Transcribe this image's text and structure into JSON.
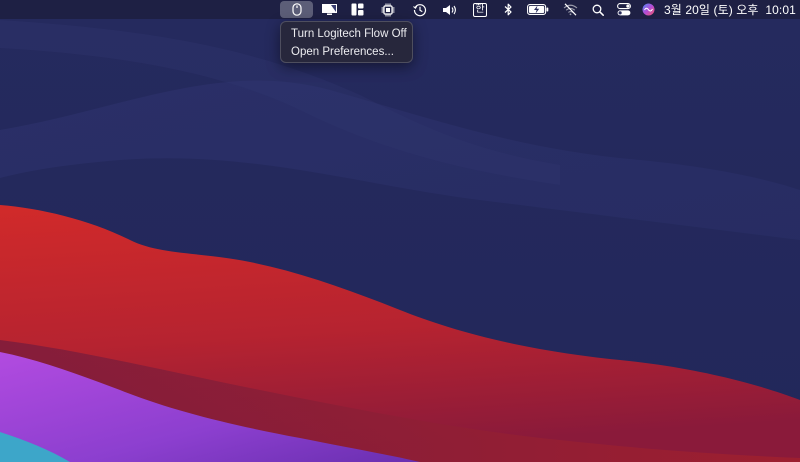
{
  "menubar": {
    "status_icons": [
      {
        "name": "logitech-flow-icon",
        "active": true
      },
      {
        "name": "display-icon"
      },
      {
        "name": "window-layout-icon"
      },
      {
        "name": "cpu-chip-icon"
      },
      {
        "name": "time-machine-icon"
      },
      {
        "name": "volume-icon"
      },
      {
        "name": "korean-input-icon",
        "label": "한"
      },
      {
        "name": "bluetooth-icon"
      },
      {
        "name": "battery-charging-icon"
      },
      {
        "name": "wifi-off-icon"
      },
      {
        "name": "spotlight-search-icon"
      },
      {
        "name": "control-center-icon"
      },
      {
        "name": "siri-icon"
      }
    ],
    "clock": "3월 20일 (토) 오후  10:01"
  },
  "dropdown": {
    "items": [
      {
        "label": "Turn Logitech Flow Off"
      },
      {
        "label": "Open Preferences..."
      }
    ]
  },
  "colors": {
    "sky": "#262a5c",
    "red_wave": "#c22a2c",
    "purple_wave": "#9a45d6",
    "menubar": "#1c1e3e"
  }
}
